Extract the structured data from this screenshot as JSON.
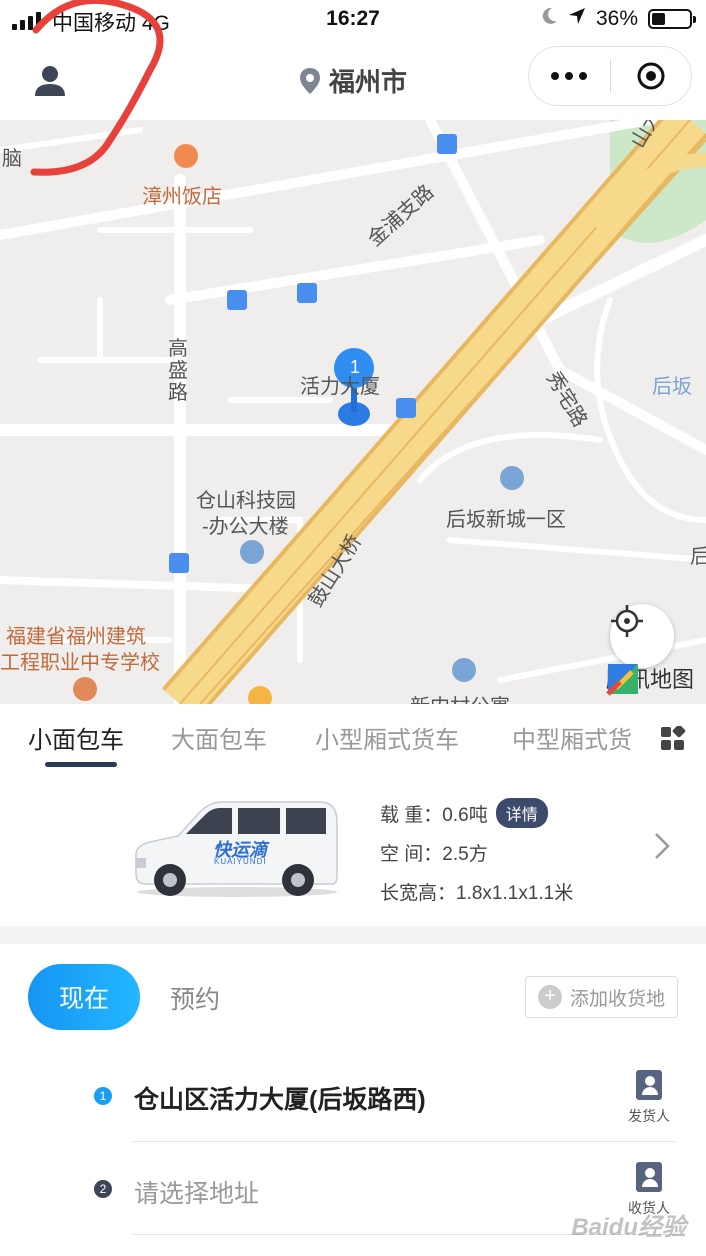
{
  "status_bar": {
    "carrier": "中国移动 4G",
    "time": "16:27",
    "battery": "36%",
    "battery_level": 0.36
  },
  "nav": {
    "city": "福州市"
  },
  "map": {
    "labels": {
      "l1": "脑",
      "l2": "漳州饭店",
      "l3": "金浦支路",
      "l4": "高盛路",
      "l5": "活力大厦",
      "l6": "秀宅路",
      "l7": "后坂",
      "l8": "仓山科技园",
      "l9": "-办公大楼",
      "l10": "后坂新城一区",
      "l11": "鼓山大桥",
      "l12": "福建省福州建筑",
      "l13": "工程职业中专学校",
      "l14": "新内村公寓",
      "l15": "山大桥",
      "l16": "后"
    },
    "marker_number": "1",
    "logo": "腾讯地图"
  },
  "vehicle_tabs": [
    "小面包车",
    "大面包车",
    "小型厢式货车",
    "中型厢式货"
  ],
  "vehicle": {
    "brand": "快运滴",
    "brand_sub": "KUAIYUNDI",
    "load": "载 重：0.6吨",
    "detail": "详情",
    "space": "空 间：2.5方",
    "size": "长宽高：1.8x1.1x1.1米"
  },
  "order": {
    "now": "现在",
    "book": "预约",
    "add_destination": "添加收货地",
    "origin_index": "1",
    "origin": "仓山区活力大厦(后坂路西)",
    "sender": "发货人",
    "dest_index": "2",
    "dest_placeholder": "请选择地址",
    "receiver": "收货人"
  },
  "watermark": "Baidu经验",
  "colors": {
    "accent": "#1a9ef5",
    "nav_dark": "#2b3a55",
    "road_yellow": "#f4cf7a"
  }
}
